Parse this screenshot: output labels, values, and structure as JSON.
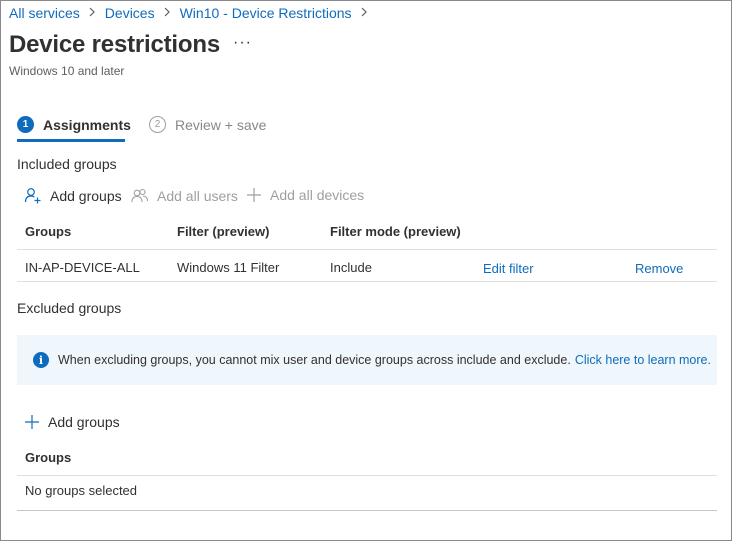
{
  "breadcrumb": {
    "items": [
      "All services",
      "Devices",
      "Win10 - Device Restrictions"
    ]
  },
  "page": {
    "title": "Device restrictions",
    "more": "···",
    "subtitle": "Windows 10 and later"
  },
  "wizard": {
    "steps": [
      {
        "number": "1",
        "label": "Assignments",
        "active": true
      },
      {
        "number": "2",
        "label": "Review + save",
        "active": false
      }
    ]
  },
  "included": {
    "heading": "Included groups",
    "commands": {
      "add_groups": "Add groups",
      "add_all_users": "Add all users",
      "add_all_devices": "Add all devices"
    },
    "columns": [
      "Groups",
      "Filter (preview)",
      "Filter mode (preview)"
    ],
    "rows": [
      {
        "group": "IN-AP-DEVICE-ALL",
        "filter": "Windows 11 Filter",
        "filter_mode": "Include",
        "edit_filter": "Edit filter",
        "remove": "Remove"
      }
    ]
  },
  "excluded": {
    "heading": "Excluded groups",
    "info": {
      "message": "When excluding groups, you cannot mix user and device groups across include and exclude.",
      "link": "Click here to learn more."
    },
    "add_groups": "Add groups",
    "column": "Groups",
    "empty": "No groups selected"
  },
  "colors": {
    "accent": "#0f6cbd",
    "info_bg": "#eff6fc",
    "disabled": "#a19f9d"
  }
}
